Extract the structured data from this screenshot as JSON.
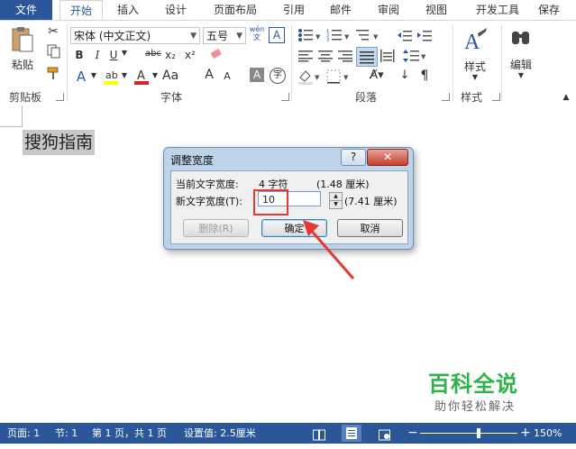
{
  "menu": {
    "file": "文件",
    "tabs": [
      "开始",
      "插入",
      "设计",
      "页面布局",
      "引用",
      "邮件",
      "审阅",
      "视图",
      "开发工具",
      "保存"
    ]
  },
  "ribbon": {
    "clipboard": {
      "paste_label": "粘贴",
      "group_label": "剪贴板"
    },
    "font": {
      "font_name": "宋体 (中文正文)",
      "font_size": "五号",
      "wen_label": "wén",
      "bold": "B",
      "italic": "I",
      "underline": "U",
      "strike": "abc",
      "subscript": "x₂",
      "superscript": "x²",
      "grow": "A",
      "shrink": "A",
      "group_label": "字体"
    },
    "paragraph": {
      "group_label": "段落"
    },
    "styles": {
      "label": "样式",
      "group_label": "样式"
    },
    "editing": {
      "label": "编辑"
    }
  },
  "document": {
    "text": "搜狗指南"
  },
  "dialog": {
    "title": "调整宽度",
    "help": "?",
    "close": "✕",
    "current_label": "当前文字宽度:",
    "current_value": "4 字符",
    "current_cm": "(1.48 厘米)",
    "new_label": "新文字宽度(T):",
    "new_value": "10",
    "new_cm": "(7.41 厘米)",
    "delete_btn": "删除(R)",
    "ok_btn": "确定",
    "cancel_btn": "取消"
  },
  "status": {
    "page": "页面: 1",
    "section": "节: 1",
    "page_of": "第 1 页，共 1 页",
    "setting": "设置值: 2.5厘米",
    "zoom": "150%",
    "zoom_level": 0.6
  },
  "watermark": {
    "title": "百科全说",
    "subtitle": "助你轻松解决"
  },
  "colors": {
    "accent": "#2b579a",
    "highlight": "#e53935",
    "watermark": "#2fb24a"
  }
}
